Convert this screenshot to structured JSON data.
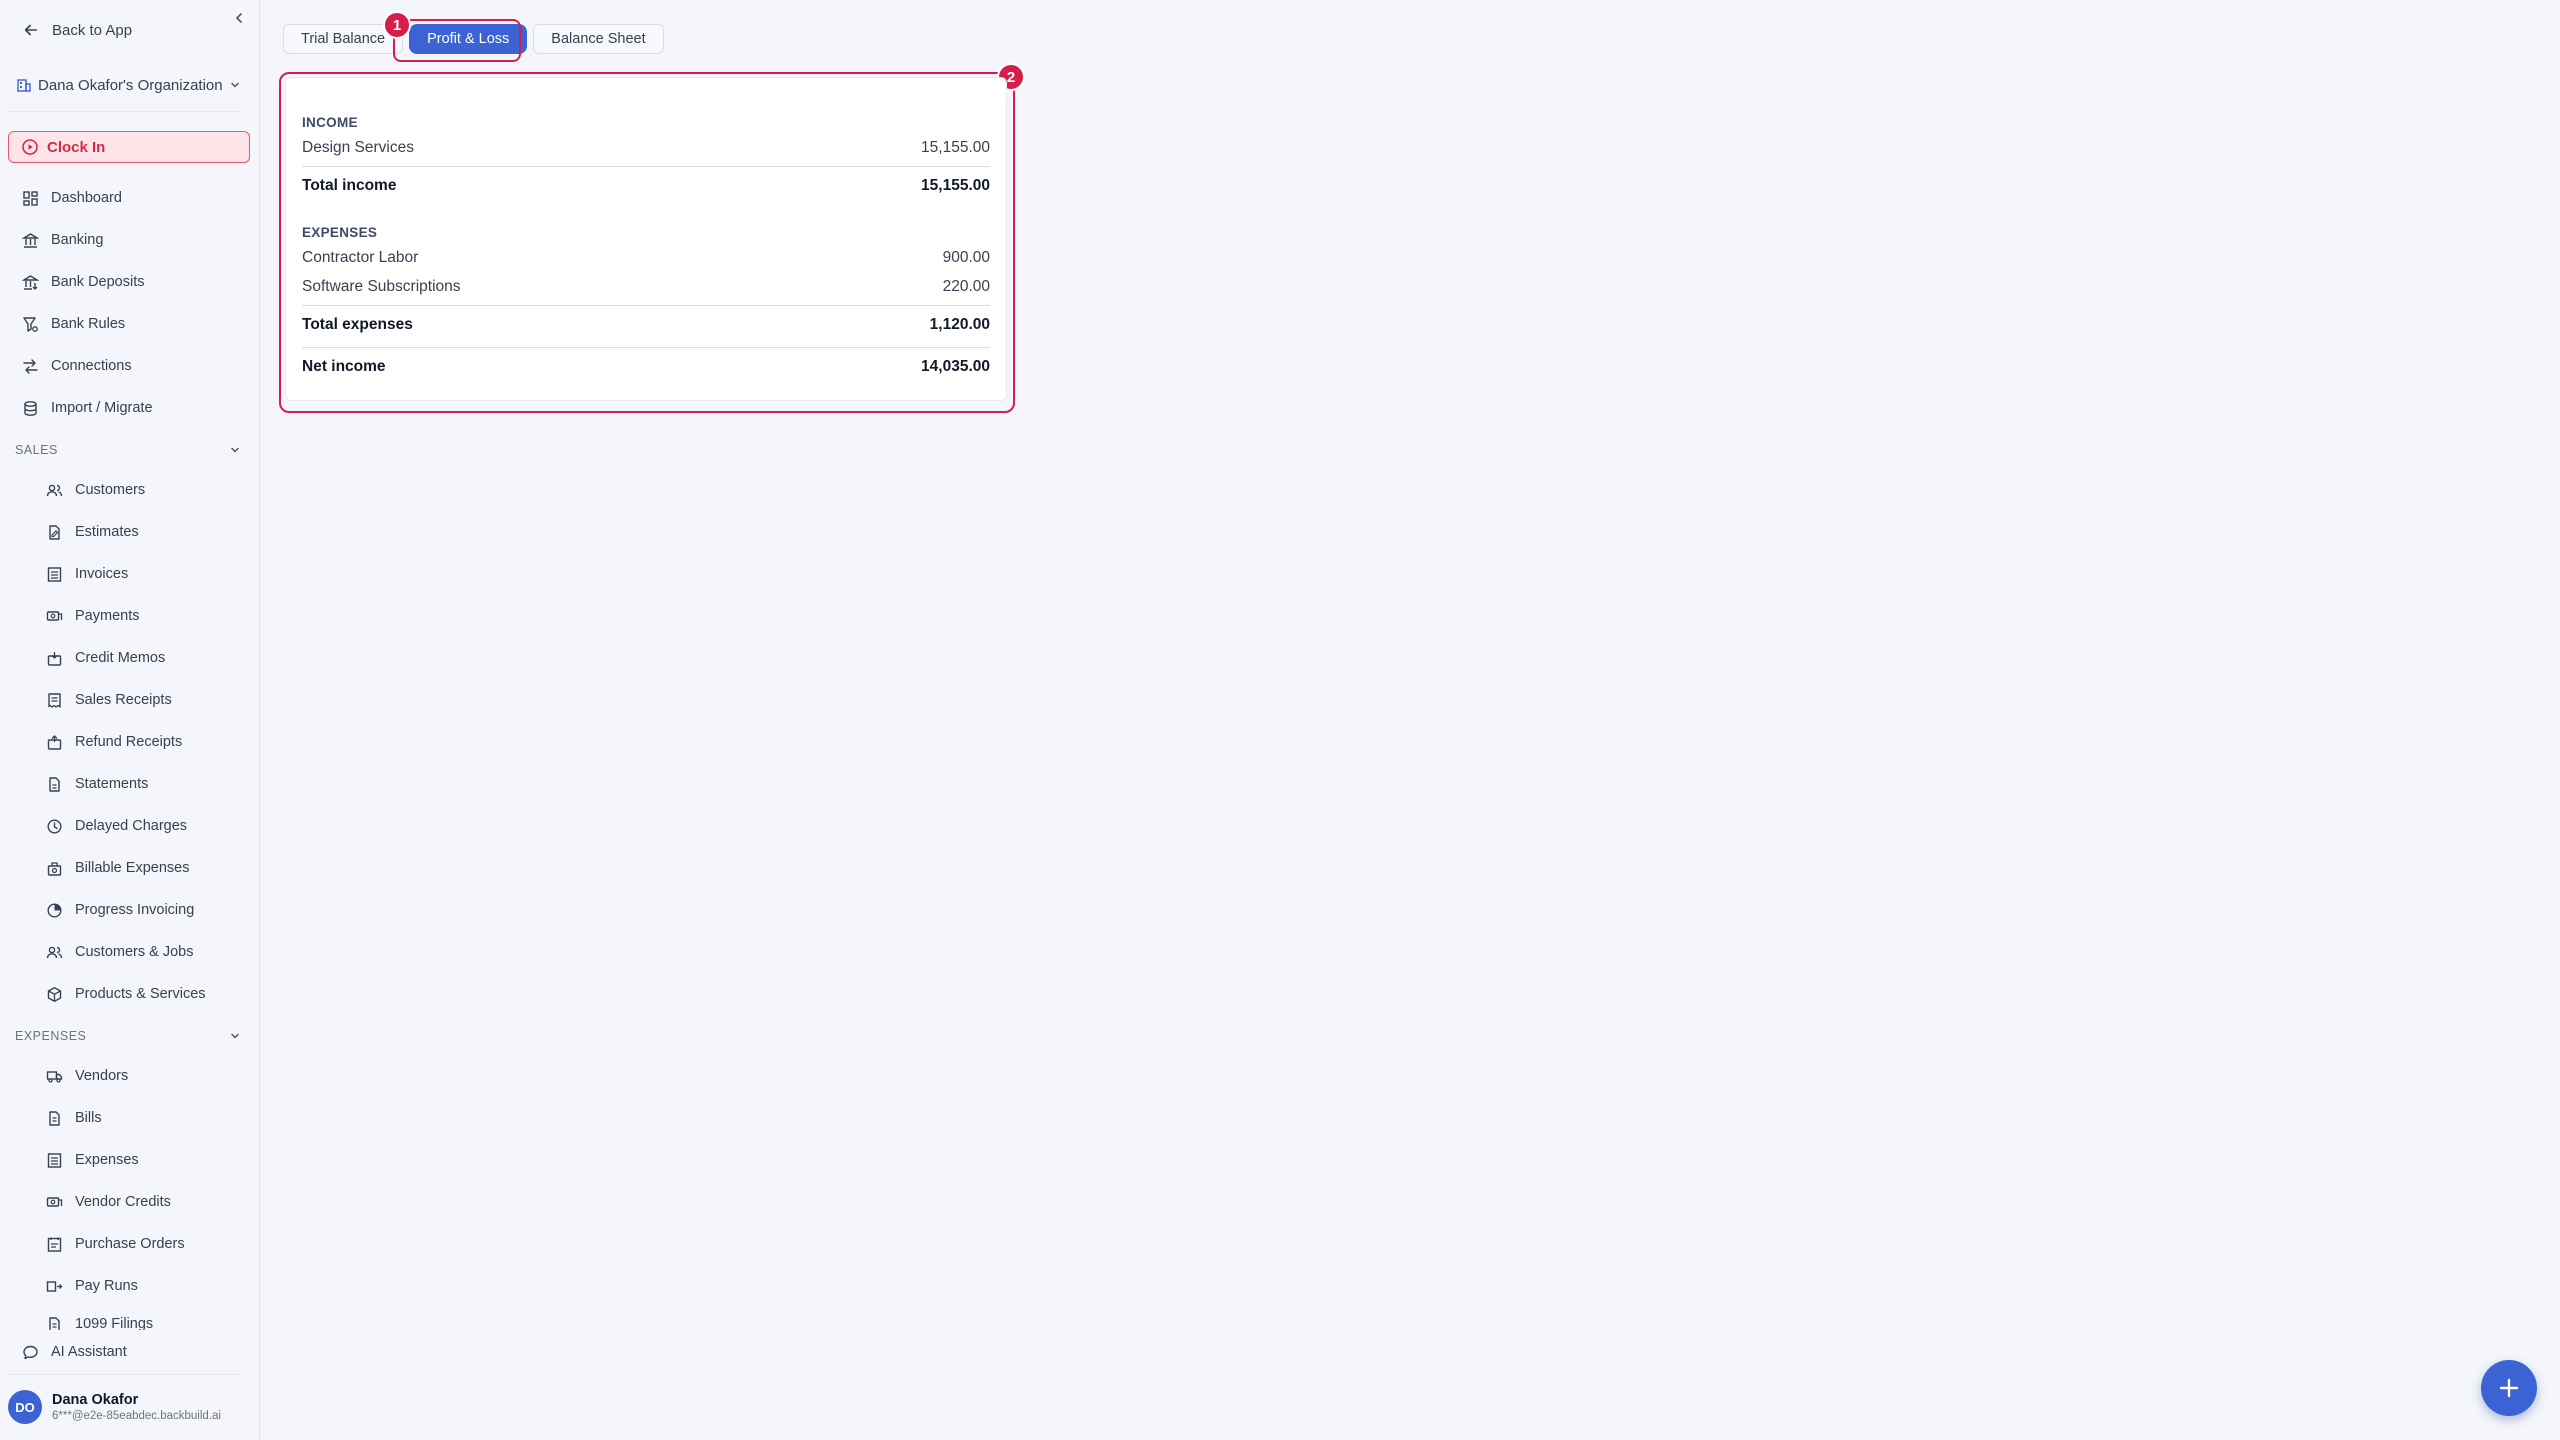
{
  "sidebar": {
    "back_label": "Back to App",
    "org_name": "Dana Okafor's Organization",
    "clock_in_label": "Clock In",
    "top_items": [
      {
        "label": "Dashboard",
        "icon": "dashboard-icon"
      },
      {
        "label": "Banking",
        "icon": "bank-icon"
      },
      {
        "label": "Bank Deposits",
        "icon": "bank-deposit-icon"
      },
      {
        "label": "Bank Rules",
        "icon": "bank-rules-icon"
      },
      {
        "label": "Connections",
        "icon": "connections-icon"
      },
      {
        "label": "Import / Migrate",
        "icon": "database-icon"
      }
    ],
    "sales": {
      "title": "SALES",
      "items": [
        {
          "label": "Customers"
        },
        {
          "label": "Estimates"
        },
        {
          "label": "Invoices"
        },
        {
          "label": "Payments"
        },
        {
          "label": "Credit Memos"
        },
        {
          "label": "Sales Receipts"
        },
        {
          "label": "Refund Receipts"
        },
        {
          "label": "Statements"
        },
        {
          "label": "Delayed Charges"
        },
        {
          "label": "Billable Expenses"
        },
        {
          "label": "Progress Invoicing"
        },
        {
          "label": "Customers & Jobs"
        },
        {
          "label": "Products & Services"
        }
      ]
    },
    "expenses": {
      "title": "EXPENSES",
      "items": [
        {
          "label": "Vendors"
        },
        {
          "label": "Bills"
        },
        {
          "label": "Expenses"
        },
        {
          "label": "Vendor Credits"
        },
        {
          "label": "Purchase Orders"
        },
        {
          "label": "Pay Runs"
        },
        {
          "label": "1099 Filings"
        }
      ]
    },
    "ai_assistant_label": "AI Assistant",
    "user": {
      "initials": "DO",
      "name": "Dana Okafor",
      "email": "6***@e2e-85eabdec.backbuild.ai"
    }
  },
  "tabs": [
    {
      "label": "Trial Balance",
      "active": false
    },
    {
      "label": "Profit & Loss",
      "active": true
    },
    {
      "label": "Balance Sheet",
      "active": false
    }
  ],
  "annotations": [
    "1",
    "2"
  ],
  "report": {
    "income": {
      "title": "INCOME",
      "rows": [
        {
          "label": "Design Services",
          "amount": "15,155.00"
        }
      ],
      "total_label": "Total income",
      "total_amount": "15,155.00"
    },
    "expenses": {
      "title": "EXPENSES",
      "rows": [
        {
          "label": "Contractor Labor",
          "amount": "900.00"
        },
        {
          "label": "Software Subscriptions",
          "amount": "220.00"
        }
      ],
      "total_label": "Total expenses",
      "total_amount": "1,120.00"
    },
    "net_label": "Net income",
    "net_amount": "14,035.00"
  },
  "fab_icon": "plus-icon",
  "colors": {
    "accent": "#3b63d3",
    "highlight": "#d81e48",
    "clock_in_bg": "#fde4e8",
    "clock_in_text": "#d62a45"
  }
}
